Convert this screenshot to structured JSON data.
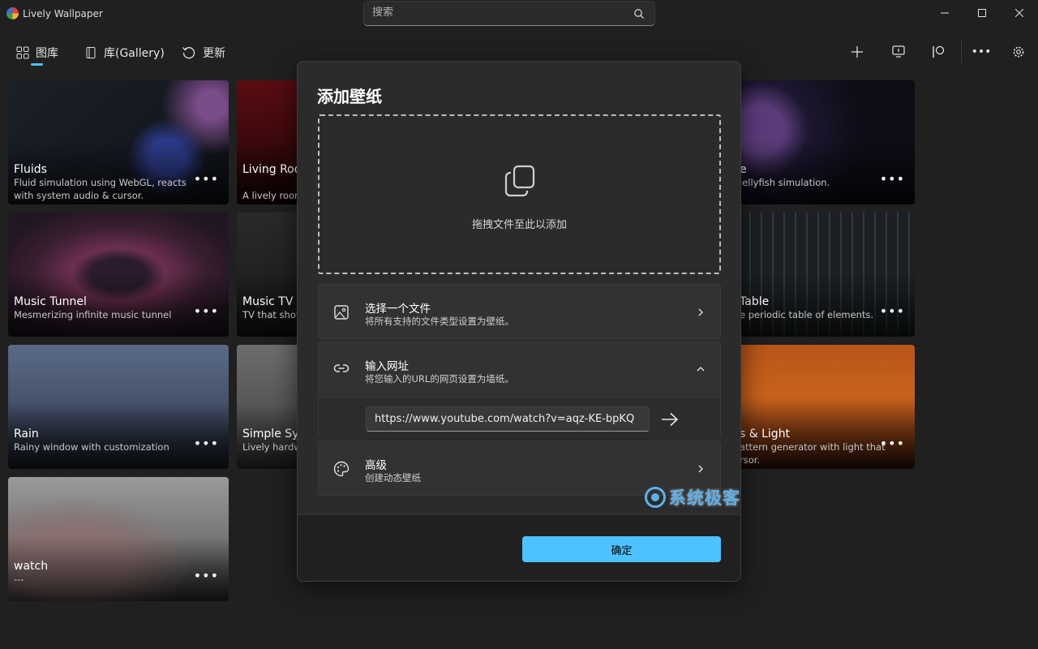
{
  "app": {
    "title": "Lively Wallpaper"
  },
  "search": {
    "placeholder": "搜索"
  },
  "nav": {
    "gallery_label": "图库",
    "library_label": "库(Gallery)",
    "update_label": "更新"
  },
  "toolbar": {
    "more_glyph": "•••"
  },
  "cards": [
    {
      "title": "Fluids",
      "desc": "Fluid simulation using WebGL, reacts with system audio & cursor.",
      "more": "•••"
    },
    {
      "title": "Living Room",
      "desc": "A lively room more!",
      "more": "•••"
    },
    {
      "title": "e",
      "desc": "jellyfish simulation.",
      "more": "•••"
    },
    {
      "title": "Music Tunnel",
      "desc": "Mesmerizing infinite music tunnel",
      "more": "•••"
    },
    {
      "title": "Music TV (L",
      "desc": "TV that show",
      "more": "•••"
    },
    {
      "title": "Table",
      "desc": "e periodic table of elements.",
      "more": "•••"
    },
    {
      "title": "Rain",
      "desc": "Rainy window with customization",
      "more": "•••"
    },
    {
      "title": "Simple Syst",
      "desc": "Lively hardw",
      "more": "•••"
    },
    {
      "title": "s & Light",
      "desc": "attern generator with light that rsor.",
      "more": "•••"
    },
    {
      "title": "watch",
      "desc": "---",
      "more": "•••"
    }
  ],
  "dialog": {
    "title": "添加壁纸",
    "drop_text": "拖拽文件至此以添加",
    "choose_file": {
      "title": "选择一个文件",
      "subtitle": "将所有支持的文件类型设置为壁纸。"
    },
    "enter_url": {
      "title": "输入网址",
      "subtitle": "将您输入的URL的网页设置为墙纸。",
      "value": "https://www.youtube.com/watch?v=aqz-KE-bpKQ"
    },
    "advanced": {
      "title": "高级",
      "subtitle": "创建动态壁纸"
    },
    "ok_label": "确定"
  },
  "watermark": {
    "text": "系统极客"
  },
  "colors": {
    "accent": "#4cc2ff",
    "background": "#202020",
    "dialog": "#2b2b2b"
  }
}
